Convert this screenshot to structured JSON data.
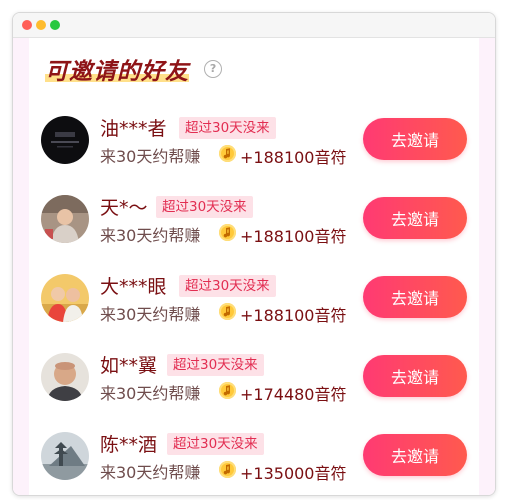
{
  "section": {
    "title": "可邀请的好友",
    "help_symbol": "?"
  },
  "friends": [
    {
      "name": "油***者",
      "badge": "超过30天没来",
      "desc": "来30天约帮赚",
      "reward": "+188100音符",
      "button": "去邀请",
      "avatar": "dark-night-photo"
    },
    {
      "name": "天*～",
      "badge": "超过30天没来",
      "desc": "来30天约帮赚",
      "reward": "+188100音符",
      "button": "去邀请",
      "avatar": "child-photo"
    },
    {
      "name": "大***眼",
      "badge": "超过30天没来",
      "desc": "来30天约帮赚",
      "reward": "+188100音符",
      "button": "去邀请",
      "avatar": "children-photo"
    },
    {
      "name": "如**翼",
      "badge": "超过30天没来",
      "desc": "来30天约帮赚",
      "reward": "+174480音符",
      "button": "去邀请",
      "avatar": "man-portrait"
    },
    {
      "name": "陈**酒",
      "badge": "超过30天没来",
      "desc": "来30天约帮赚",
      "reward": "+135000音符",
      "button": "去邀请",
      "avatar": "pagoda-landscape"
    }
  ],
  "colors": {
    "title": "#8e1417",
    "badge_bg": "#fde1e7",
    "badge_text": "#e22e52",
    "button_start": "#ff3a73",
    "button_end": "#ff5a4e"
  }
}
